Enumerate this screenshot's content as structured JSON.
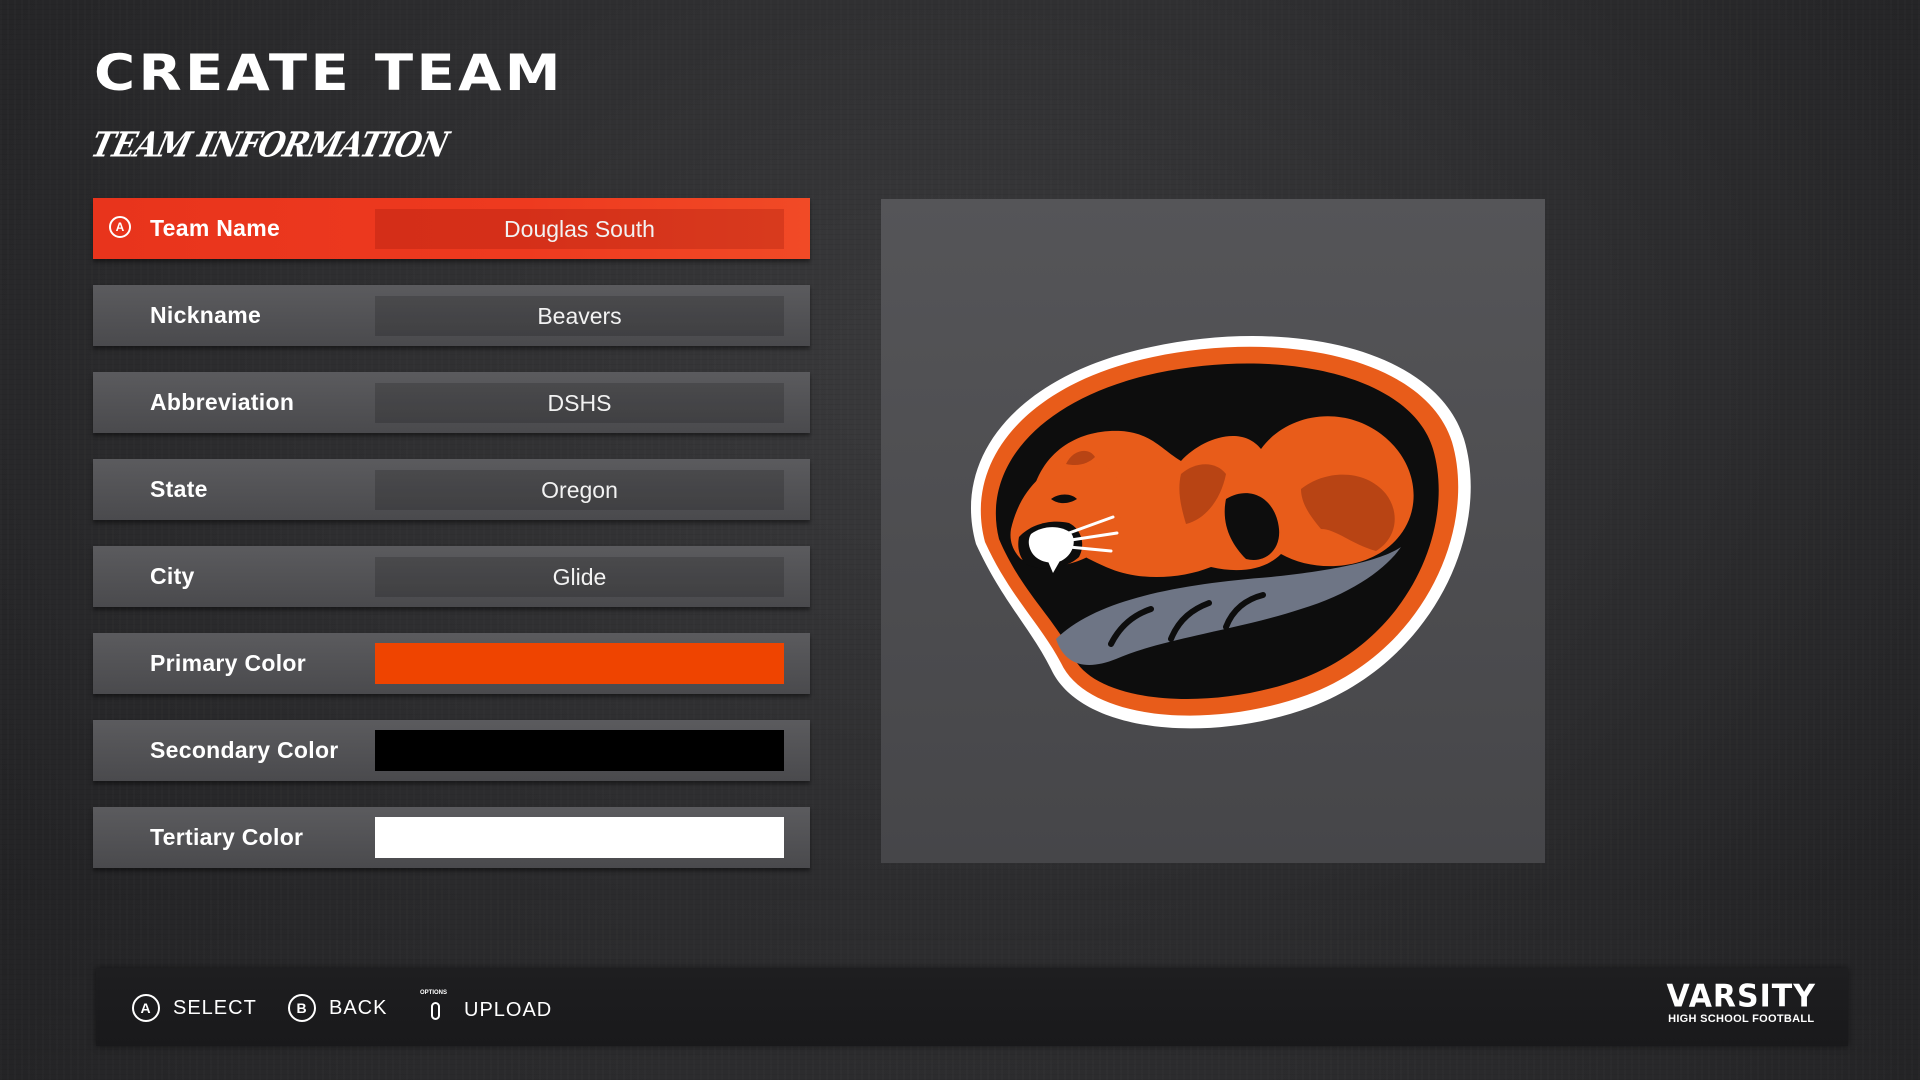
{
  "header": {
    "title": "CREATE TEAM",
    "subtitle": "TEAM INFORMATION"
  },
  "form": {
    "rows": [
      {
        "label": "Team Name",
        "value": "Douglas South",
        "type": "text",
        "selected": true,
        "button_glyph": "A"
      },
      {
        "label": "Nickname",
        "value": "Beavers",
        "type": "text"
      },
      {
        "label": "Abbreviation",
        "value": "DSHS",
        "type": "text"
      },
      {
        "label": "State",
        "value": "Oregon",
        "type": "text"
      },
      {
        "label": "City",
        "value": "Glide",
        "type": "text"
      },
      {
        "label": "Primary Color",
        "type": "color",
        "color": "#ef4400"
      },
      {
        "label": "Secondary Color",
        "type": "color",
        "color": "#000000"
      },
      {
        "label": "Tertiary Color",
        "type": "color",
        "color": "#ffffff"
      }
    ]
  },
  "logo": {
    "icon": "beaver-logo",
    "colors": {
      "primary": "#e85c1a",
      "dark": "#b84414",
      "secondary": "#0d0d0d",
      "tertiary": "#ffffff",
      "tail": "#6e7585"
    }
  },
  "footer": {
    "hints": [
      {
        "glyph": "A",
        "label": "SELECT",
        "icon": "a-button-icon"
      },
      {
        "glyph": "B",
        "label": "BACK",
        "icon": "b-button-icon"
      },
      {
        "glyph": "OPTIONS",
        "label": "UPLOAD",
        "icon": "options-button-icon"
      }
    ],
    "brand": {
      "main": "VARSITY",
      "sub": "HIGH SCHOOL FOOTBALL"
    }
  }
}
